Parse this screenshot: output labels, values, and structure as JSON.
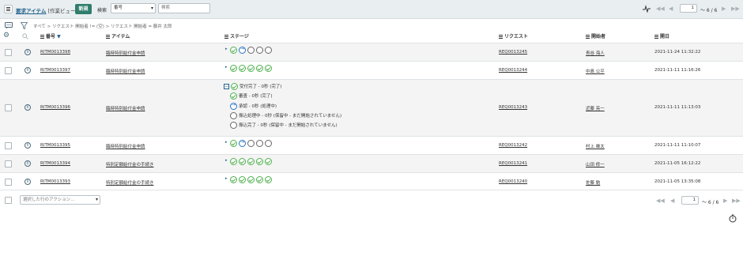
{
  "header": {
    "title_link": "要求アイテム",
    "title_rest": "[作業ビュー]",
    "new_button": "新規",
    "search_label": "検索",
    "search_field": "番号",
    "search_placeholder": "検索",
    "page_input": "1",
    "page_text": "～ 6 / 6"
  },
  "breadcrumb": "すべて > リクエスト 開始者 != (空) > リクエスト 開始者 = 藤井 太郎",
  "columns": {
    "number": "番号",
    "item": "アイテム",
    "stage": "ステージ",
    "request": "リクエスト",
    "opened_by": "開始者",
    "opened": "開日"
  },
  "rows": [
    {
      "number": "RITM0013398",
      "item": "臨時特別給付金申請",
      "stage_states": [
        "done",
        "prog",
        "todo",
        "todo",
        "todo"
      ],
      "request": "REQ0013245",
      "opened_by": "青谷 海人",
      "opened": "2021-11-24 11:32:22"
    },
    {
      "number": "RITM0013397",
      "item": "臨時特別給付金申請",
      "stage_states": [
        "done",
        "done",
        "done",
        "done",
        "done"
      ],
      "request": "REQ0013244",
      "opened_by": "中島 公平",
      "opened": "2021-11-11 11:16:26"
    },
    {
      "number": "RITM0013396",
      "item": "臨時特別給付金申請",
      "request": "REQ0013243",
      "opened_by": "近藤 亮一",
      "opened": "2021-11-11 11:13:03"
    },
    {
      "number": "RITM0013395",
      "item": "臨時特別給付金申請",
      "stage_states": [
        "done",
        "prog",
        "todo",
        "todo",
        "todo"
      ],
      "request": "REQ0013242",
      "opened_by": "村上 雄太",
      "opened": "2021-11-11 11:10:07"
    },
    {
      "number": "RITM0013394",
      "item": "特別定額給付金の手続き",
      "stage_states": [
        "done",
        "done",
        "done",
        "done",
        "done"
      ],
      "request": "REQ0013241",
      "opened_by": "山田 修一",
      "opened": "2021-11-05 16:12:22"
    },
    {
      "number": "RITM0013393",
      "item": "特別定額給付金の手続き",
      "stage_states": [
        "done",
        "done",
        "done",
        "done",
        "done"
      ],
      "request": "REQ0013240",
      "opened_by": "佐藤 勉",
      "opened": "2021-11-05 13:35:08"
    }
  ],
  "expanded_stages": [
    {
      "label": "受付完了 - 0秒 (完了)",
      "state": "done"
    },
    {
      "label": "審査 - 0秒 (完了)",
      "state": "done"
    },
    {
      "label": "承認 - 0秒 (処理中)",
      "state": "prog"
    },
    {
      "label": "振込処理中 - 0秒 (保留中 - まだ開始されていません)",
      "state": "todo"
    },
    {
      "label": "振込完了 - 0秒 (保留中 - まだ開始されていません)",
      "state": "todo"
    }
  ],
  "footer": {
    "action_select": "選択した行のアクション...",
    "page_input": "1",
    "page_text": "～ 6 / 6"
  },
  "icons": {
    "menu": "hamburger-icon",
    "activity": "activity-stream-icon",
    "filter": "funnel-icon",
    "settings": "gear-icon",
    "info": "info-icon",
    "timer": "stopwatch-icon"
  }
}
